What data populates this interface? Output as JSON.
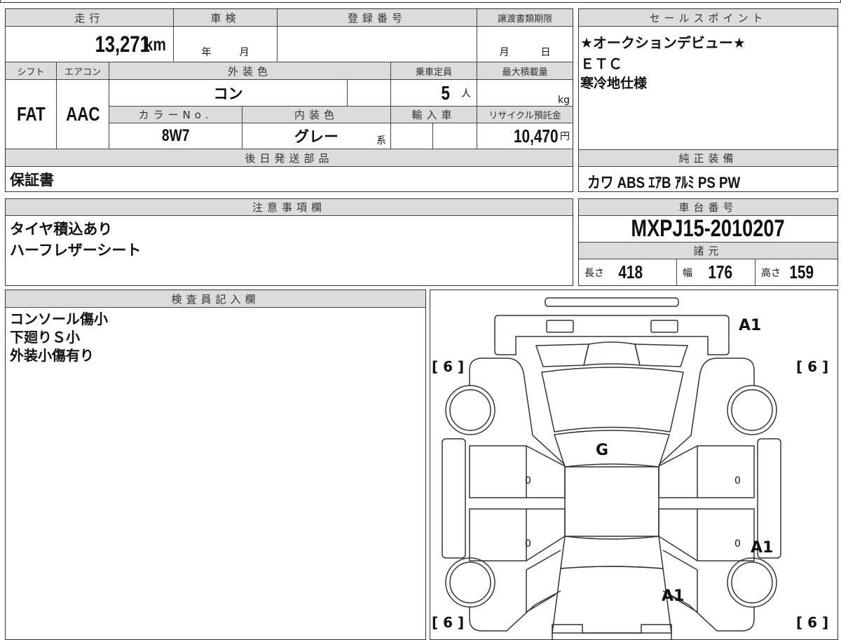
{
  "vehicle_table": {
    "headers": {
      "mileage": "走行",
      "inspection": "車検",
      "registration": "登録番号",
      "transfer_deadline": "譲渡書類期限",
      "shift": "シフト",
      "aircon": "エアコン",
      "exterior_color": "外装色",
      "capacity": "乗車定員",
      "max_load": "最大積載量",
      "color_no": "カラーNo.",
      "interior_color": "内装色",
      "imported": "輸入車",
      "recycle_fee": "リサイクル預託金",
      "later_parts": "後日発送部品"
    },
    "mileage": "13,271",
    "mileage_unit": "km",
    "inspection_year": "年",
    "inspection_month": "月",
    "transfer_month": "月",
    "transfer_day": "日",
    "shift": "FAT",
    "aircon": "AAC",
    "exterior_color": "コン",
    "capacity": "5",
    "capacity_unit": "人",
    "max_load_unit": "kg",
    "color_no": "8W7",
    "interior_color": "グレー",
    "interior_suffix": "系",
    "recycle_fee": "10,470",
    "recycle_unit": "円",
    "later_parts": "保証書"
  },
  "sales_points": {
    "header": "セールスポイント",
    "lines": [
      "★オークションデビュー★",
      "ＥＴＣ",
      "寒冷地仕様"
    ]
  },
  "factory_equipment": {
    "header": "純正装備",
    "value": "カワ ABS ｴｱB ｱﾙﾐ PS PW"
  },
  "notes": {
    "header": "注意事項欄",
    "lines": [
      "タイヤ積込あり",
      "ハーフレザーシート"
    ]
  },
  "chassis": {
    "header": "車台番号",
    "value": "MXPJ15-2010207",
    "spec_header": "諸元",
    "length_label": "長さ",
    "length": "418",
    "width_label": "幅",
    "width": "176",
    "height_label": "高さ",
    "height": "159"
  },
  "inspector": {
    "header": "検査員記入欄",
    "lines": [
      "コンソール傷小",
      "下廻りＳ小",
      "外装小傷有り"
    ]
  },
  "diagram": {
    "marks": {
      "front_bumper": "A1",
      "windshield": "G",
      "rear_right_door": "A1",
      "trunk": "A1",
      "front_left_door": "0",
      "rear_left_door": "0",
      "front_right_door": "0",
      "rear_right_door_count": "0"
    },
    "tires": {
      "front_left": "[ 6 ]",
      "front_right": "[ 6 ]",
      "rear_left": "[ 6 ]",
      "rear_right": "[ 6 ]"
    }
  }
}
